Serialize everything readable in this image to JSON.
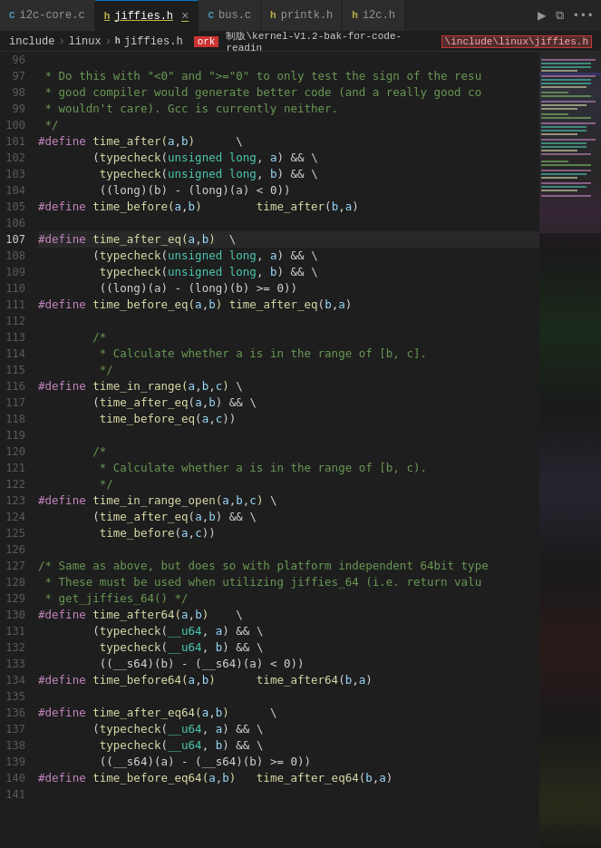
{
  "tabs": [
    {
      "id": "tab-i2c-core",
      "icon": "c",
      "label": "i2c-core.c",
      "active": false,
      "closeable": false
    },
    {
      "id": "tab-jiffies",
      "icon": "h",
      "label": "jiffies.h",
      "active": true,
      "closeable": true
    },
    {
      "id": "tab-bus",
      "icon": "c",
      "label": "bus.c",
      "active": false,
      "closeable": false
    },
    {
      "id": "tab-printk",
      "icon": "h",
      "label": "printk.h",
      "active": false,
      "closeable": false
    },
    {
      "id": "tab-i2ch",
      "icon": "h",
      "label": "i2c.h",
      "active": false,
      "closeable": false
    }
  ],
  "toolbar": {
    "run_icon": "▶",
    "split_icon": "⧉",
    "more_icon": "···"
  },
  "breadcrumb": {
    "parts": [
      "include",
      "linux",
      "jiffies.h"
    ],
    "full_path": "\\include\\linux\\jiffies.h"
  },
  "active_line": 107,
  "lines": [
    {
      "num": 96,
      "text": " "
    },
    {
      "num": 97,
      "text": " * Do this with \"<0\" and \">=\"0\" to only test the sign of the resu"
    },
    {
      "num": 98,
      "text": " * good compiler would generate better code (and a really good co"
    },
    {
      "num": 99,
      "text": " * wouldn't care). Gcc is currently neither."
    },
    {
      "num": 100,
      "text": " */"
    },
    {
      "num": 101,
      "text": "#define time_after(a,b)      \\"
    },
    {
      "num": 102,
      "text": "\t(typecheck(unsigned long, a) && \\"
    },
    {
      "num": 103,
      "text": "\t typecheck(unsigned long, b) && \\"
    },
    {
      "num": 104,
      "text": "\t ((long)(b) - (long)(a) < 0))"
    },
    {
      "num": 105,
      "text": "#define time_before(a,b)\ttime_after(b,a)"
    },
    {
      "num": 106,
      "text": " "
    },
    {
      "num": 107,
      "text": "#define time_after_eq(a,b)  \\"
    },
    {
      "num": 108,
      "text": "\t(typecheck(unsigned long, a) && \\"
    },
    {
      "num": 109,
      "text": "\t typecheck(unsigned long, b) && \\"
    },
    {
      "num": 110,
      "text": "\t ((long)(a) - (long)(b) >= 0))"
    },
    {
      "num": 111,
      "text": "#define time_before_eq(a,b) time_after_eq(b,a)"
    },
    {
      "num": 112,
      "text": " "
    },
    {
      "num": 113,
      "text": "\t/*"
    },
    {
      "num": 114,
      "text": "\t * Calculate whether a is in the range of [b, c]."
    },
    {
      "num": 115,
      "text": "\t */"
    },
    {
      "num": 116,
      "text": "#define time_in_range(a,b,c) \\"
    },
    {
      "num": 117,
      "text": "\t(time_after_eq(a,b) && \\"
    },
    {
      "num": 118,
      "text": "\t time_before_eq(a,c))"
    },
    {
      "num": 119,
      "text": " "
    },
    {
      "num": 120,
      "text": "\t/*"
    },
    {
      "num": 121,
      "text": "\t * Calculate whether a is in the range of [b, c)."
    },
    {
      "num": 122,
      "text": "\t */"
    },
    {
      "num": 123,
      "text": "#define time_in_range_open(a,b,c) \\"
    },
    {
      "num": 124,
      "text": "\t(time_after_eq(a,b) && \\"
    },
    {
      "num": 125,
      "text": "\t time_before(a,c))"
    },
    {
      "num": 126,
      "text": " "
    },
    {
      "num": 127,
      "text": "/* Same as above, but does so with platform independent 64bit type"
    },
    {
      "num": 128,
      "text": " * These must be used when utilizing jiffies_64 (i.e. return valu"
    },
    {
      "num": 129,
      "text": " * get_jiffies_64() */"
    },
    {
      "num": 130,
      "text": "#define time_after64(a,b)    \\"
    },
    {
      "num": 131,
      "text": "\t(typecheck(__u64, a) && \\"
    },
    {
      "num": 132,
      "text": "\t typecheck(__u64, b) && \\"
    },
    {
      "num": 133,
      "text": "\t ((__s64)(b) - (__s64)(a) < 0))"
    },
    {
      "num": 134,
      "text": "#define time_before64(a,b)\ttime_after64(b,a)"
    },
    {
      "num": 135,
      "text": " "
    },
    {
      "num": 136,
      "text": "#define time_after_eq64(a,b)      \\"
    },
    {
      "num": 137,
      "text": "\t(typecheck(__u64, a) && \\"
    },
    {
      "num": 138,
      "text": "\t typecheck(__u64, b) && \\"
    },
    {
      "num": 139,
      "text": "\t ((__s64)(a) - (__s64)(b) >= 0))"
    },
    {
      "num": 140,
      "text": "#define time_before_eq64(a,b)\ttime_after_eq64(b,a)"
    },
    {
      "num": 141,
      "text": " "
    }
  ]
}
